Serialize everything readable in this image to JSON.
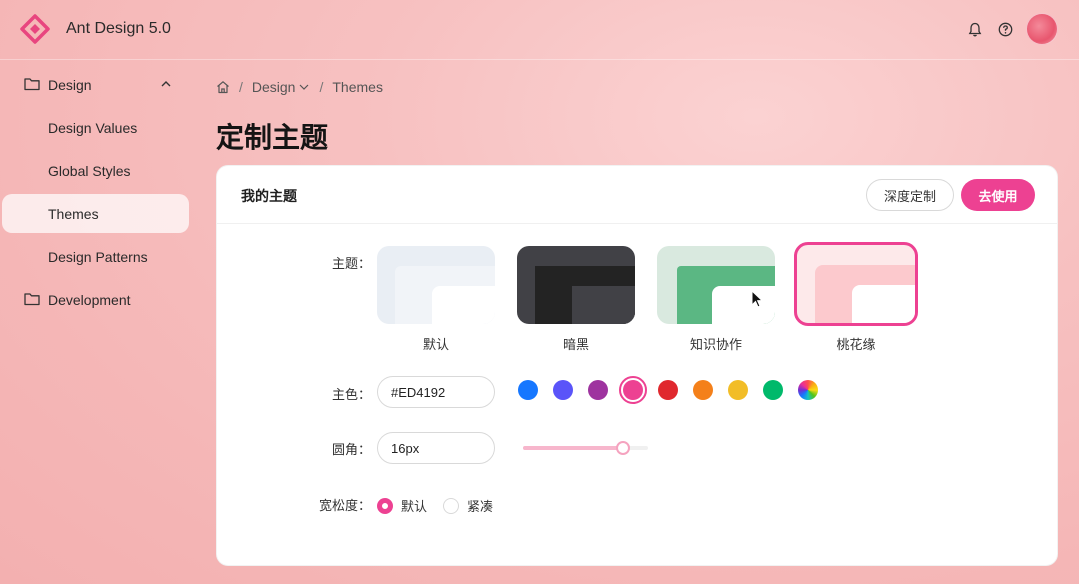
{
  "header": {
    "app_title": "Ant Design 5.0",
    "bell_icon": "bell-icon",
    "help_icon": "question-circle-icon"
  },
  "sidebar": {
    "items": [
      {
        "label": "Design",
        "type": "group",
        "icon": "folder-icon",
        "expanded": true
      },
      {
        "label": "Design Values",
        "type": "sub"
      },
      {
        "label": "Global Styles",
        "type": "sub"
      },
      {
        "label": "Themes",
        "type": "sub",
        "active": true
      },
      {
        "label": "Design Patterns",
        "type": "sub"
      },
      {
        "label": "Development",
        "type": "group",
        "icon": "folder-icon"
      }
    ]
  },
  "breadcrumb": {
    "home_icon": "home-icon",
    "items": [
      "Design",
      "Themes"
    ]
  },
  "page": {
    "title": "定制主题"
  },
  "card": {
    "title": "我的主题",
    "customize_button": "深度定制",
    "use_button": "去使用",
    "theme_label": "主题：",
    "themes": [
      {
        "name": "默认"
      },
      {
        "name": "暗黑"
      },
      {
        "name": "知识协作"
      },
      {
        "name": "桃花缘",
        "selected": true
      }
    ],
    "color_label": "主色：",
    "color_value": "#ED4192",
    "swatches": [
      "#1677FF",
      "#5A54F9",
      "#9E339F",
      "#ED4192",
      "#E0282E",
      "#F4801A",
      "#F2BD27",
      "#00B96B"
    ],
    "radius_label": "圆角：",
    "radius_value": "16px",
    "radius_slider_fraction": 0.8,
    "density_label": "宽松度：",
    "density_options": [
      {
        "label": "默认",
        "checked": true
      },
      {
        "label": "紧凑",
        "checked": false
      }
    ]
  },
  "colors": {
    "primary": "#ED4192"
  }
}
